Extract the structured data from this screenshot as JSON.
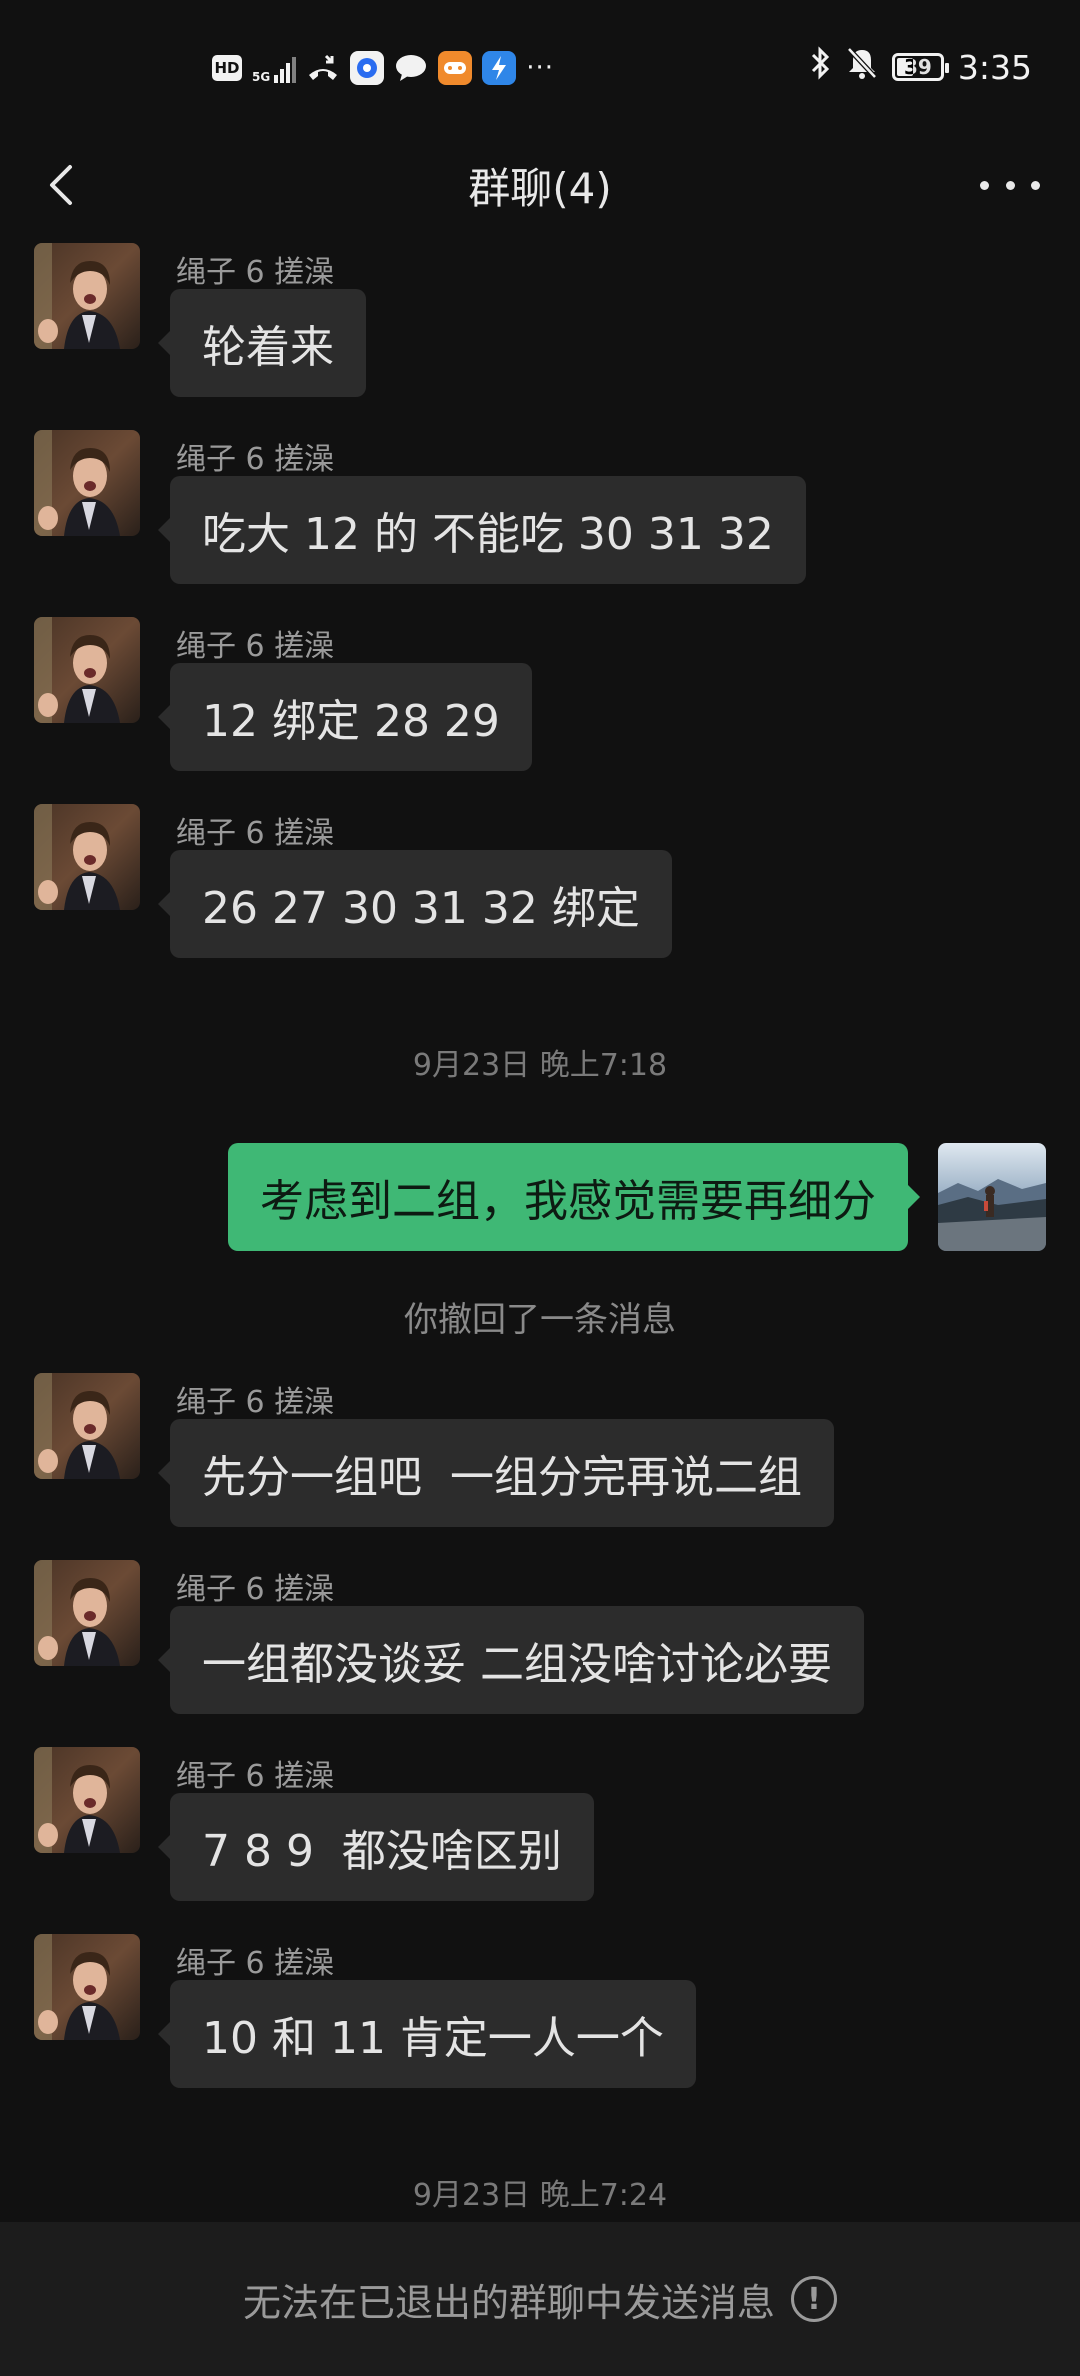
{
  "status_bar": {
    "hd_label": "HD",
    "network_label": "5G",
    "app_icons": [
      "missed-call-icon",
      "browser-icon",
      "chat-icon",
      "game-icon",
      "bolt-icon"
    ],
    "more_indicator": "···",
    "battery_level": "39",
    "time": "3:35"
  },
  "nav": {
    "title": "群聊(4)"
  },
  "messages": [
    {
      "sender": "绳子 6 搓澡",
      "text": "轮着来"
    },
    {
      "sender": "绳子 6 搓澡",
      "text": "吃大 12 的 不能吃 30 31 32"
    },
    {
      "sender": "绳子 6 搓澡",
      "text": "12 绑定 28 29"
    },
    {
      "sender": "绳子 6 搓澡",
      "text": "26 27 30 31 32 绑定"
    },
    {
      "sender": "绳子 6 搓澡",
      "text": "先分一组吧  一组分完再说二组"
    },
    {
      "sender": "绳子 6 搓澡",
      "text": "一组都没谈妥 二组没啥讨论必要"
    },
    {
      "sender": "绳子 6 搓澡",
      "text": "7 8 9  都没啥区别"
    },
    {
      "sender": "绳子 6 搓澡",
      "text": "10 和 11 肯定一人一个"
    }
  ],
  "timestamps": [
    "9月23日 晚上7:18",
    "9月23日 晚上7:24"
  ],
  "my_message": "考虑到二组，我感觉需要再细分",
  "recall_notice": "你撤回了一条消息",
  "bottom_bar": {
    "text": "无法在已退出的群聊中发送消息",
    "info_glyph": "!"
  },
  "colors": {
    "background": "#111111",
    "bubble_other": "#2c2c2c",
    "bubble_mine": "#3fb875"
  }
}
